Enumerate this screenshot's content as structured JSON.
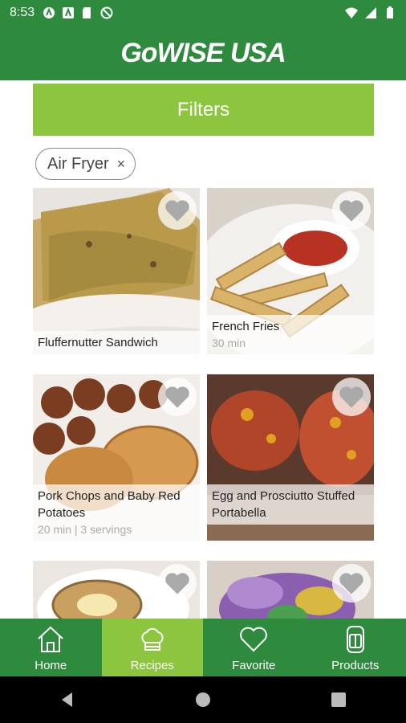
{
  "status_bar": {
    "time": "8:53",
    "left_icons": [
      "a-circle-icon",
      "a-square-icon",
      "sd-card-icon",
      "no-sync-icon"
    ],
    "right_icons": [
      "wifi-icon",
      "cellular-icon",
      "battery-icon"
    ]
  },
  "app": {
    "logo_text": "GoWISE USA"
  },
  "filters": {
    "button_label": "Filters"
  },
  "active_filter_chip": {
    "label": "Air Fryer",
    "close_glyph": "×"
  },
  "recipes": [
    {
      "title": "Fluffernutter Sandwich",
      "meta": "",
      "favorite": false
    },
    {
      "title": "French Fries",
      "meta": "30 min",
      "favorite": false
    },
    {
      "title": "Pork Chops and Baby Red Potatoes",
      "meta": "20 min | 3 servings",
      "favorite": false
    },
    {
      "title": "Egg and Prosciutto Stuffed Portabella",
      "meta": "",
      "favorite": false
    },
    {
      "title": "",
      "meta": "",
      "favorite": false
    },
    {
      "title": "",
      "meta": "",
      "favorite": false
    }
  ],
  "bottom_nav": {
    "items": [
      {
        "label": "Home",
        "icon": "house-icon",
        "active": false
      },
      {
        "label": "Recipes",
        "icon": "chef-hat-icon",
        "active": true
      },
      {
        "label": "Favorite",
        "icon": "heart-icon",
        "active": false
      },
      {
        "label": "Products",
        "icon": "air-fryer-icon",
        "active": false
      }
    ]
  },
  "colors": {
    "primary_green": "#2e8b3e",
    "accent_green": "#8cc63f"
  }
}
